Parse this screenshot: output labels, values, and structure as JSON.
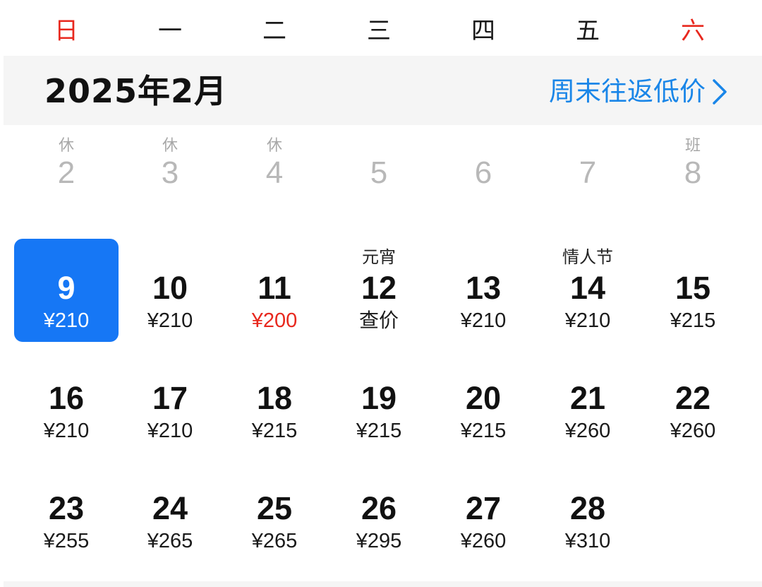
{
  "weekdays": [
    "日",
    "一",
    "二",
    "三",
    "四",
    "五",
    "六"
  ],
  "month": {
    "title": "2025年2月",
    "promo_link": "周末往返低价"
  },
  "past_days": [
    {
      "day": "2",
      "note": "休"
    },
    {
      "day": "3",
      "note": "休"
    },
    {
      "day": "4",
      "note": "休"
    },
    {
      "day": "5",
      "note": ""
    },
    {
      "day": "6",
      "note": ""
    },
    {
      "day": "7",
      "note": ""
    },
    {
      "day": "8",
      "note": "班"
    }
  ],
  "days": [
    {
      "day": "9",
      "note": "",
      "price": "¥210"
    },
    {
      "day": "10",
      "note": "",
      "price": "¥210"
    },
    {
      "day": "11",
      "note": "",
      "price": "¥200"
    },
    {
      "day": "12",
      "note": "元宵",
      "price": "查价"
    },
    {
      "day": "13",
      "note": "",
      "price": "¥210"
    },
    {
      "day": "14",
      "note": "情人节",
      "price": "¥210"
    },
    {
      "day": "15",
      "note": "",
      "price": "¥215"
    },
    {
      "day": "16",
      "note": "",
      "price": "¥210"
    },
    {
      "day": "17",
      "note": "",
      "price": "¥210"
    },
    {
      "day": "18",
      "note": "",
      "price": "¥215"
    },
    {
      "day": "19",
      "note": "",
      "price": "¥215"
    },
    {
      "day": "20",
      "note": "",
      "price": "¥215"
    },
    {
      "day": "21",
      "note": "",
      "price": "¥260"
    },
    {
      "day": "22",
      "note": "",
      "price": "¥260"
    },
    {
      "day": "23",
      "note": "",
      "price": "¥255"
    },
    {
      "day": "24",
      "note": "",
      "price": "¥265"
    },
    {
      "day": "25",
      "note": "",
      "price": "¥265"
    },
    {
      "day": "26",
      "note": "",
      "price": "¥295"
    },
    {
      "day": "27",
      "note": "",
      "price": "¥260"
    },
    {
      "day": "28",
      "note": "",
      "price": "¥310"
    }
  ],
  "colors": {
    "accent": "#1677f5",
    "link": "#1a86e8",
    "weekend": "#e8281e",
    "lowest_price": "#e8281e",
    "month_bar_bg": "#f5f5f5"
  }
}
